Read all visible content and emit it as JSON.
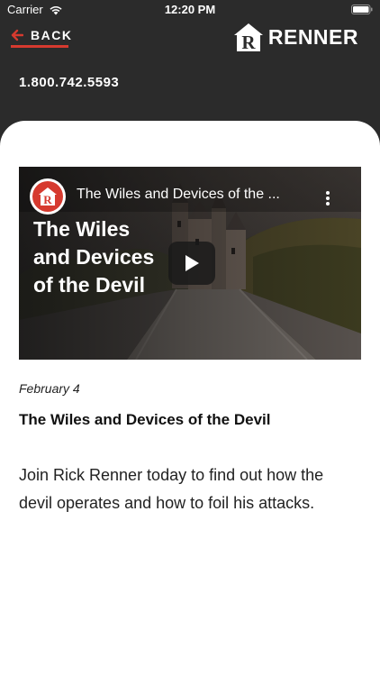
{
  "status_bar": {
    "carrier": "Carrier",
    "time": "12:20 PM",
    "wifi_icon": "wifi-icon",
    "battery_icon": "battery-icon"
  },
  "header": {
    "back_label": "BACK",
    "back_icon": "arrow-left-icon",
    "logo_letter": "R",
    "logo_text": "RENNER",
    "phone": "1.800.742.5593"
  },
  "video": {
    "title": "The Wiles and Devices of the ...",
    "channel_letter": "R",
    "thumbnail_heading": [
      "The Wiles",
      "and Devices",
      "of the Devil"
    ],
    "play_icon": "play-icon",
    "more_icon": "more-vertical-icon"
  },
  "post": {
    "date": "February 4",
    "title": "The Wiles and Devices of the Devil",
    "body": "Join Rick Renner today to find out how the devil operates and how to foil his attacks."
  },
  "colors": {
    "header_bg": "#2b2b2b",
    "accent": "#d63a2f",
    "card_bg": "#ffffff"
  }
}
